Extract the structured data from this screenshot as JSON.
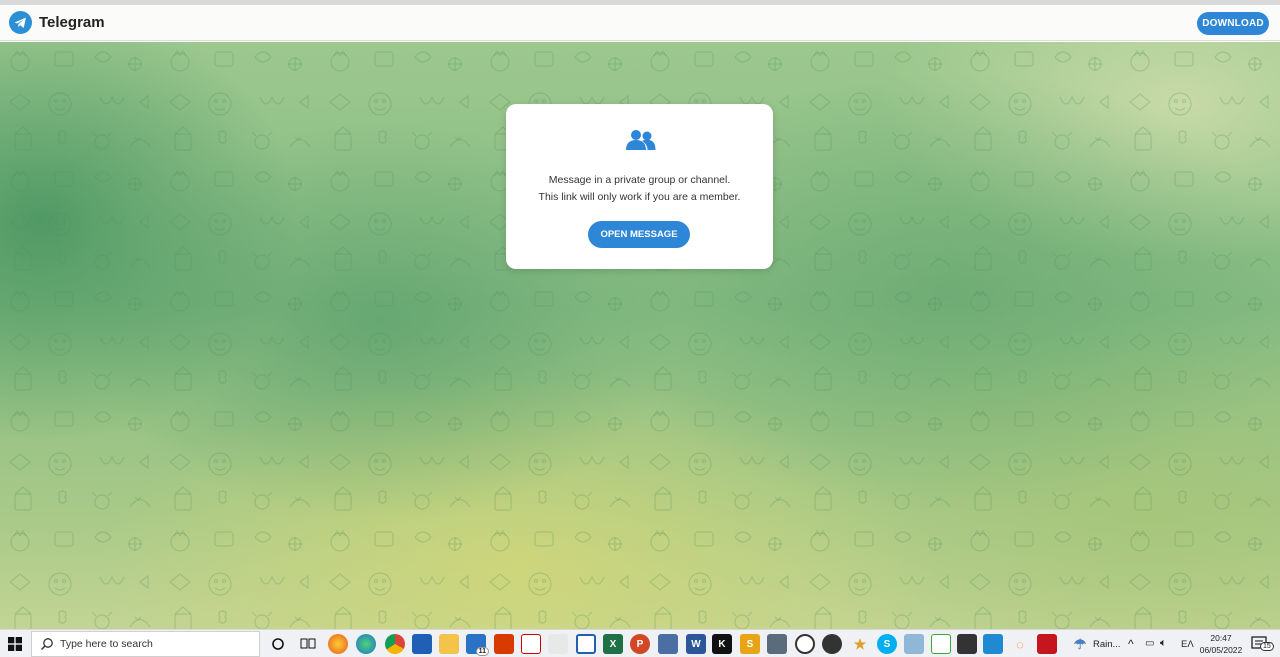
{
  "header": {
    "app_name": "Telegram",
    "download_label": "DOWNLOAD",
    "logo_icon": "telegram-logo-icon"
  },
  "card": {
    "icon": "group-icon",
    "line1": "Message in a private group or channel.",
    "line2": "This link will only work if you are a member.",
    "button_label": "OPEN MESSAGE"
  },
  "colors": {
    "accent": "#2e86d6",
    "background_green": "#86bb82",
    "background_yellow": "#c2d494"
  },
  "taskbar": {
    "search_placeholder": "Type here to search",
    "weather_label": "Rain...",
    "language": "EΛ",
    "time": "20:47",
    "date": "06/05/2022",
    "notification_count": "15",
    "mail_badge": "11"
  }
}
